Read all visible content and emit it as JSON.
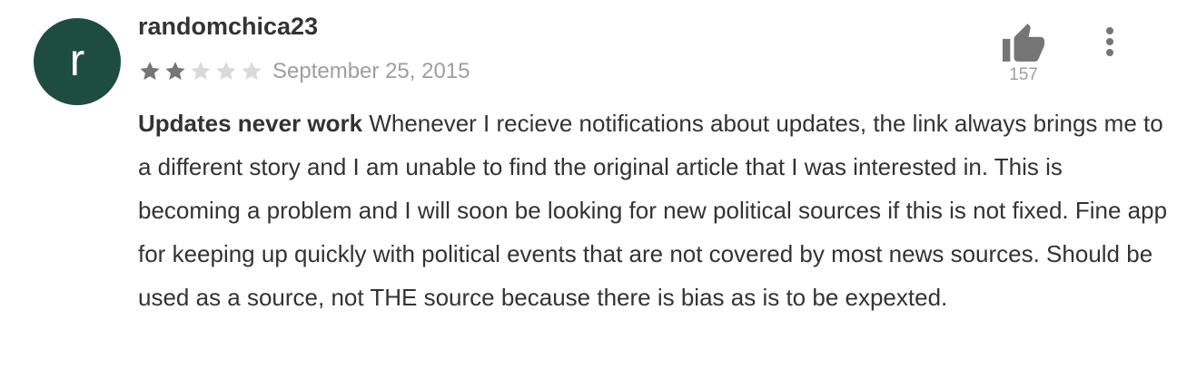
{
  "review": {
    "avatar_letter": "r",
    "avatar_color": "#1e4d40",
    "username": "randomchica23",
    "rating": 2,
    "max_rating": 5,
    "star_filled_color": "#757575",
    "star_empty_color": "#dadada",
    "date": "September 25, 2015",
    "helpful_icon": "thumbs-up-icon",
    "helpful_count": "157",
    "menu_icon": "more-vert-icon",
    "title": "Updates never work",
    "text": "Whenever I recieve notifications about updates, the link always brings me to a different story and I am unable to find the original article that I was interested in. This is becoming a problem and I will soon be looking for new political sources if this is not fixed. Fine app for keeping up quickly with political events that are not covered by most news sources. Should be used as a source, not THE source because there is bias as is to be expexted."
  }
}
